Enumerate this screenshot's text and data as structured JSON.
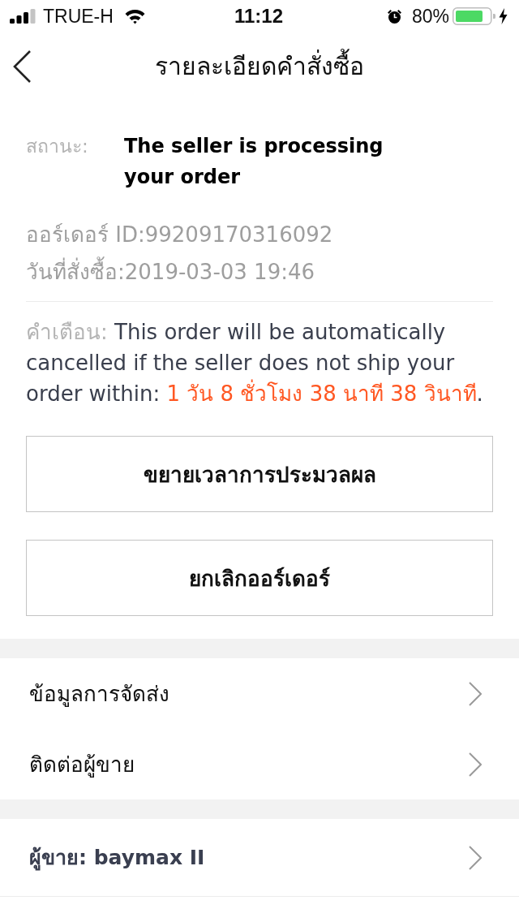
{
  "status_bar": {
    "carrier": "TRUE-H",
    "time": "11:12",
    "battery": "80%"
  },
  "nav": {
    "title": "รายละเอียดคำสั่งซื้อ"
  },
  "status": {
    "label": "สถานะ:",
    "value": "The seller is processing your order"
  },
  "order": {
    "id": "ออร์เดอร์ ID:99209170316092",
    "date": "วันที่สั่งซื้อ:2019-03-03 19:46"
  },
  "warning": {
    "label": "คำเตือน:",
    "text": "This order will be automatically cancelled if the seller does not ship your order within:",
    "countdown": "1 วัน 8 ชั่วโมง 38 นาที 38 วินาที",
    "end": "."
  },
  "buttons": [
    "ขยายเวลาการประมวลผล",
    "ยกเลิกออร์เดอร์"
  ],
  "sections": [
    {
      "rows": [
        {
          "label": "ข้อมูลการจัดส่ง",
          "kind": "link"
        },
        {
          "label": "ติดต่อผู้ขาย",
          "kind": "link"
        }
      ]
    },
    {
      "rows": [
        {
          "label": "ผู้ขาย: baymax II",
          "kind": "seller"
        }
      ]
    }
  ]
}
